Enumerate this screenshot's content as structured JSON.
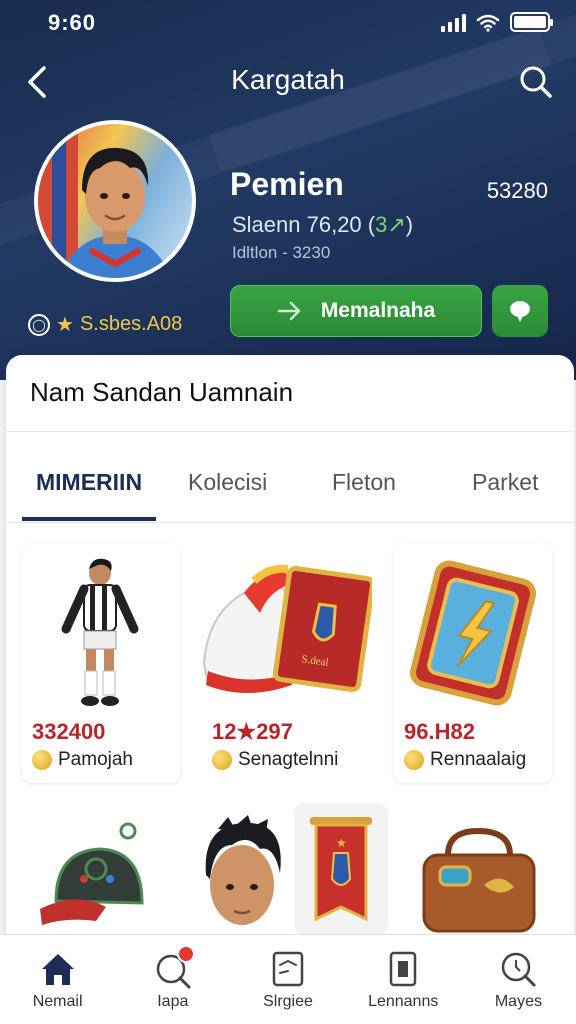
{
  "status": {
    "time": "9:60"
  },
  "header": {
    "title": "Kargatah",
    "profile": {
      "name": "Pemien",
      "score": "53280",
      "sub1": "Slaenn 76,20 (",
      "sub1_accent": "3↗",
      "sub1_end": ")",
      "sub2": "Idltlon - 3230",
      "badge_text": "S.sbes.A08"
    },
    "follow_label": "Memalnaha"
  },
  "main": {
    "section_title": "Nam Sandan Uamnain",
    "tabs": [
      {
        "label": "MIMERIIN",
        "active": true
      },
      {
        "label": "Kolecisi",
        "active": false
      },
      {
        "label": "Fleton",
        "active": false
      },
      {
        "label": "Parket",
        "active": false
      }
    ],
    "items": [
      {
        "price": "332400",
        "label": "Pamojah",
        "icon": "player-figure-icon"
      },
      {
        "price": "12★297",
        "label": "Senagtelnni",
        "icon": "boots-and-card-icon"
      },
      {
        "price": "96.H82",
        "label": "Rennaalaig",
        "icon": "golden-card-icon"
      }
    ],
    "items_row2": [
      {
        "icon": "cap-icon"
      },
      {
        "icon": "player-face-icon"
      },
      {
        "icon": "banner-icon"
      },
      {
        "icon": "bag-icon"
      }
    ]
  },
  "bottom_nav": [
    {
      "label": "Nemail",
      "icon": "home-icon"
    },
    {
      "label": "Iapa",
      "icon": "chat-search-icon",
      "notification": true
    },
    {
      "label": "Slrgiee",
      "icon": "document-icon"
    },
    {
      "label": "Lennanns",
      "icon": "card-icon"
    },
    {
      "label": "Mayes",
      "icon": "search-icon"
    }
  ],
  "colors": {
    "primary": "#1c2d57",
    "accent_green": "#2f9a3b",
    "price_red": "#b8262a",
    "gold": "#f1c74b"
  }
}
